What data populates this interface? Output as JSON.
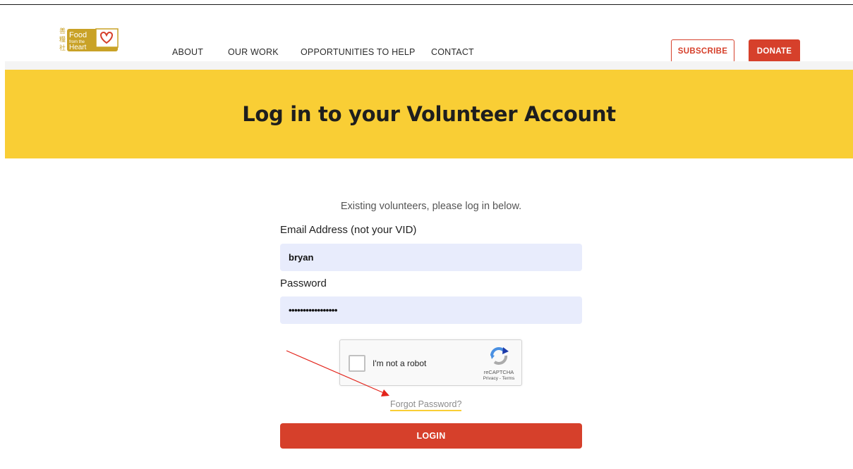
{
  "header": {
    "logo": {
      "chinese_chars": "善 糧 社",
      "line1": "Food",
      "line2": "from the",
      "line3": "Heart"
    },
    "nav": [
      {
        "label": "ABOUT"
      },
      {
        "label": "OUR WORK"
      },
      {
        "label": "OPPORTUNITIES TO HELP"
      },
      {
        "label": "CONTACT"
      }
    ],
    "subscribe_label": "SUBSCRIBE",
    "donate_label": "DONATE"
  },
  "hero": {
    "title": "Log in to your Volunteer Account"
  },
  "form": {
    "intro": "Existing volunteers, please log in below.",
    "email_label": "Email Address (not your VID)",
    "email_value": "bryan",
    "password_label": "Password",
    "password_value": "•••••••••••••••••",
    "captcha_text": "I'm not a robot",
    "captcha_brand": "reCAPTCHA",
    "captcha_links": "Privacy - Terms",
    "forgot_label": "Forgot Password?",
    "login_label": "LOGIN"
  },
  "colors": {
    "brand_yellow": "#f9ce35",
    "brand_red": "#d6402b",
    "field_bg": "#e8ecfc",
    "logo_gold": "#c9a227"
  },
  "icons": [
    "recaptcha-icon",
    "heart-icon"
  ]
}
